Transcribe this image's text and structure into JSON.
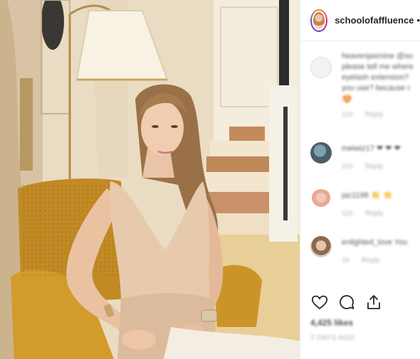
{
  "post": {
    "username": "schoolofaffluence",
    "more_icon": "ellipsis-icon"
  },
  "comments": [
    {
      "username": "heavenjasmine",
      "text_lines": [
        "heavenjasmine @so",
        "please tell me where",
        "eyelash extension?",
        "you use? because I"
      ],
      "age": "11h",
      "reply_label": "Reply",
      "emoji": "😍"
    },
    {
      "username": "meiwiz17",
      "text_lines": [
        "meiwiz17 ❤ ❤ ❤"
      ],
      "age": "11h",
      "reply_label": "Reply"
    },
    {
      "username": "jaz1198",
      "text_lines": [
        "jaz1198 👏 👏"
      ],
      "age": "11h",
      "reply_label": "Reply"
    },
    {
      "username": "enlighted_love",
      "text_lines": [
        "enlighted_love You"
      ],
      "age": "1h",
      "reply_label": "Reply"
    }
  ],
  "likes_label": "4,425 likes",
  "date_label": "2 DAYS AGO",
  "icons": {
    "like": "heart-icon",
    "comment": "comment-icon",
    "share": "share-icon"
  },
  "colors": {
    "text": "#262626",
    "muted": "#8e8e8e",
    "border": "#efefef"
  }
}
